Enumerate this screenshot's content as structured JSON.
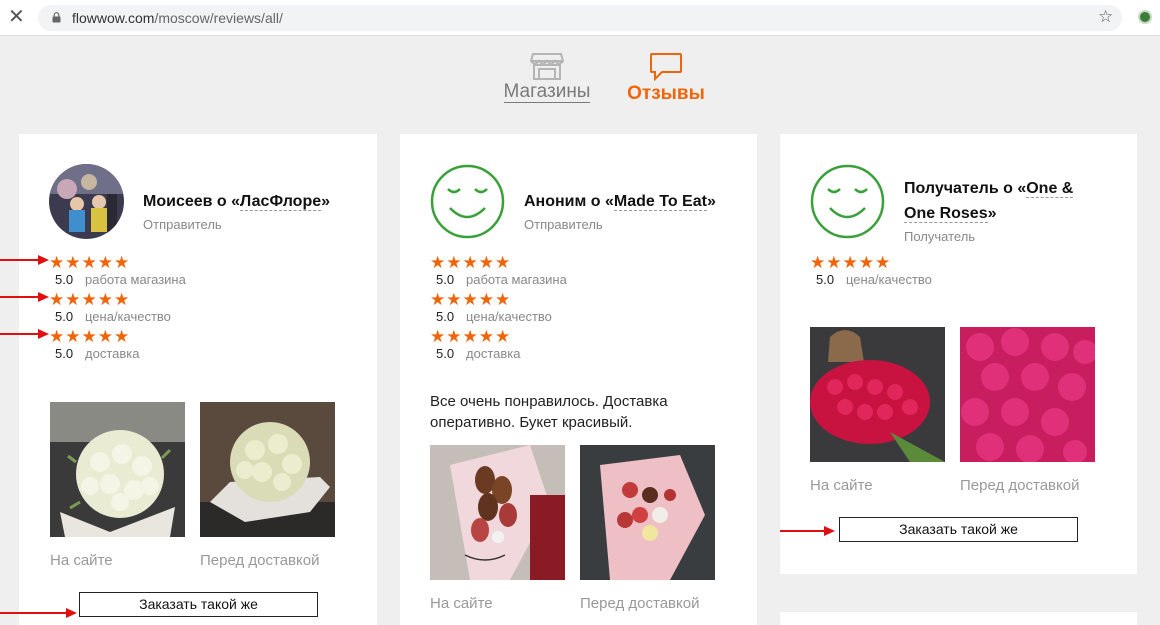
{
  "browser": {
    "url_domain": "flowwow.com",
    "url_path": "/moscow/reviews/all/"
  },
  "tabs": {
    "shops_label": "Магазины",
    "reviews_label": "Отзывы"
  },
  "colors": {
    "accent": "#f0640a",
    "smiley": "#3aa03a"
  },
  "reviews": [
    {
      "name_prefix": "Моисеев о «",
      "shop": "ЛасФлоре",
      "name_suffix": "»",
      "role": "Отправитель",
      "ratings": [
        {
          "stars": "★★★★★",
          "value": "5.0",
          "label": "работа магазина"
        },
        {
          "stars": "★★★★★",
          "value": "5.0",
          "label": "цена/качество"
        },
        {
          "stars": "★★★★★",
          "value": "5.0",
          "label": "доставка"
        }
      ],
      "photo_captions": [
        "На сайте",
        "Перед доставкой"
      ],
      "order_button": "Заказать такой же"
    },
    {
      "name_prefix": "Аноним о «",
      "shop": "Made To Eat",
      "name_suffix": "»",
      "role": "Отправитель",
      "ratings": [
        {
          "stars": "★★★★★",
          "value": "5.0",
          "label": "работа магазина"
        },
        {
          "stars": "★★★★★",
          "value": "5.0",
          "label": "цена/качество"
        },
        {
          "stars": "★★★★★",
          "value": "5.0",
          "label": "доставка"
        }
      ],
      "text": "Все очень понравилось. Доставка оперативно. Букет красивый.",
      "photo_captions": [
        "На сайте",
        "Перед доставкой"
      ]
    },
    {
      "name_prefix": "Получатель о «",
      "shop_line1": "One &",
      "shop_line2": "One Roses",
      "name_suffix": "»",
      "role": "Получатель",
      "ratings": [
        {
          "stars": "★★★★★",
          "value": "5.0",
          "label": "цена/качество"
        }
      ],
      "photo_captions": [
        "На сайте",
        "Перед доставкой"
      ],
      "order_button": "Заказать такой же"
    }
  ]
}
